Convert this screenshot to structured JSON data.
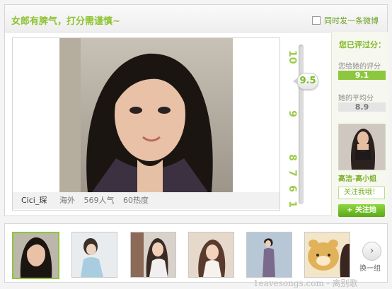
{
  "header": {
    "title": "女郎有脾气，打分需谨慎~",
    "weibo_checkbox_label": "同时发一条微博"
  },
  "photo": {
    "name": "Cici_琛",
    "location": "海外",
    "popularity": "569人气",
    "heat": "60热度"
  },
  "slider": {
    "score": "9.5",
    "ticks": [
      "10",
      "9",
      "8",
      "7",
      "6",
      "1"
    ]
  },
  "rating": {
    "title": "您已评过分：",
    "your_score_label": "您给她的评分",
    "your_score": "9.1",
    "avg_label": "她的平均分",
    "avg_score": "8.9",
    "featured_name": "高洁-高小姐",
    "follow_me": "关注我哦！",
    "follow_her": "+ 关注她"
  },
  "strip": {
    "next_label": "换一组",
    "next_icon": "chevron-right-icon"
  },
  "watermark": "1eavesongs.com - 离别歌",
  "colors": {
    "accent_green": "#8dc63f",
    "title_green": "#8ec332"
  }
}
